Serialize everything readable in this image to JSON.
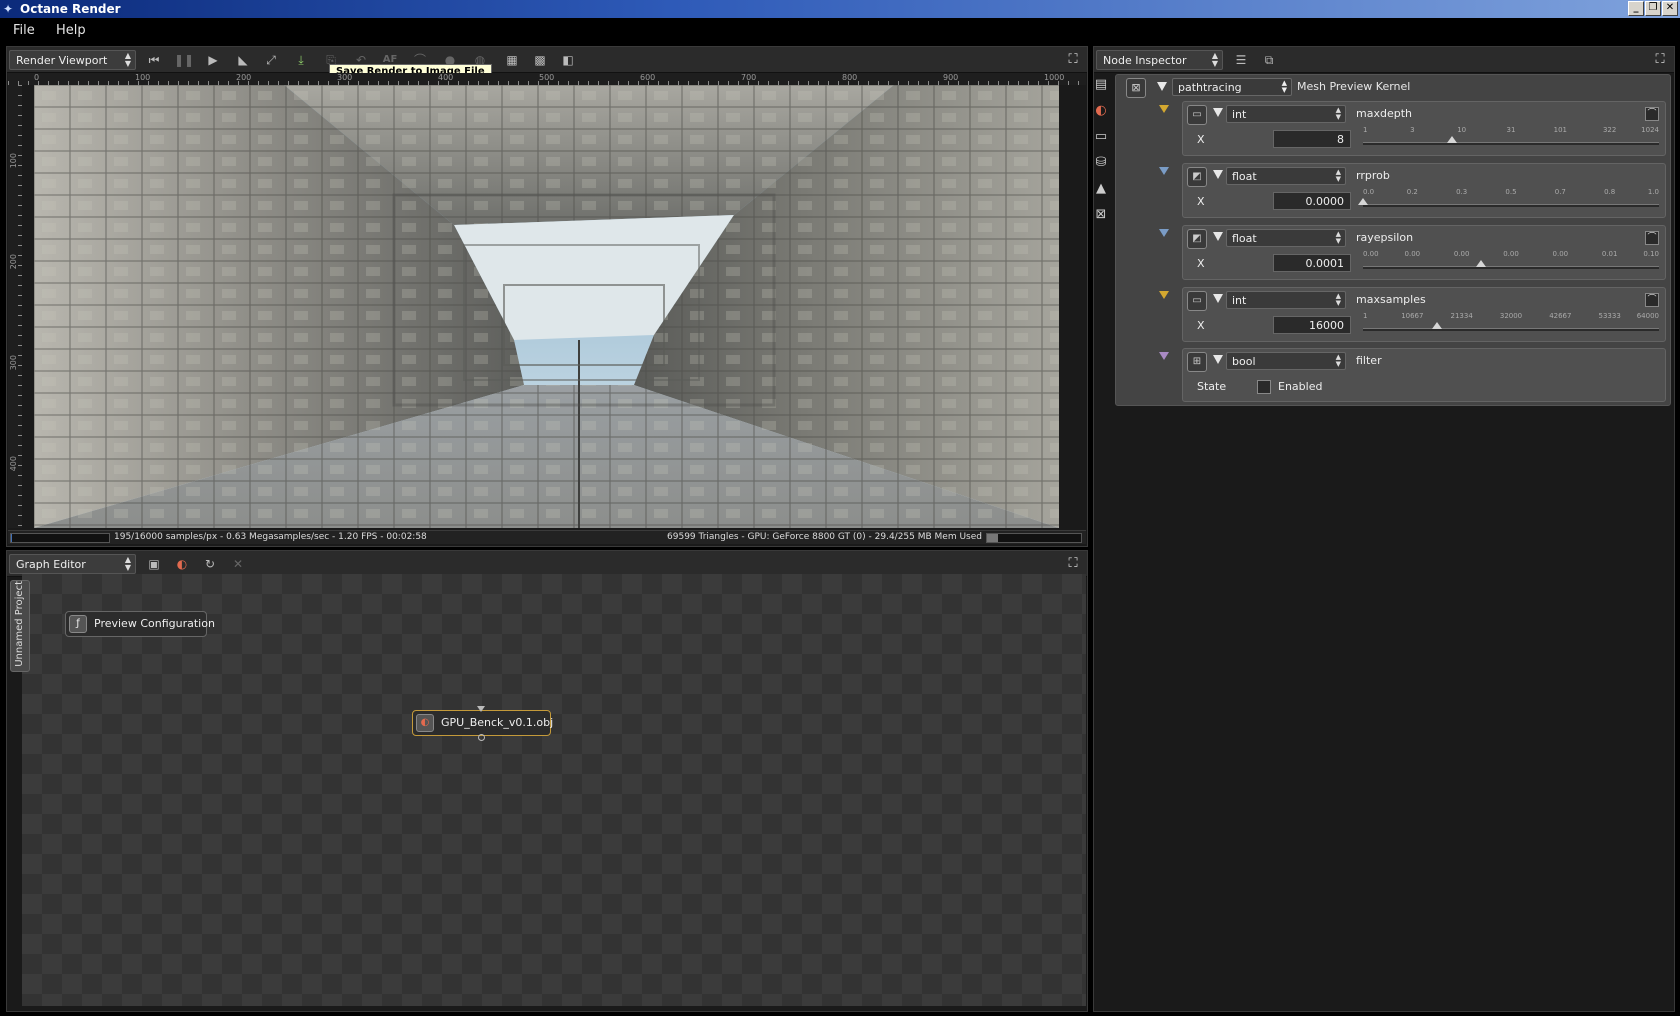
{
  "window": {
    "title": "Octane Render",
    "controls": [
      "_",
      "❐",
      "✕"
    ]
  },
  "menu": [
    "File",
    "Help"
  ],
  "render_viewport": {
    "panel_label": "Render Viewport",
    "toolbar_icons": [
      "rewind-icon",
      "pause-icon",
      "play-icon",
      "camera-icon",
      "resize-icon",
      "save-render-icon",
      "export-icon",
      "undo-icon",
      "af-icon",
      "lasso-icon",
      "color-picker-icon",
      "zoom-icon",
      "region-icon",
      "checker-icon",
      "frame-icon"
    ],
    "af_label": "AF",
    "tooltip": "Save Render to Image File",
    "ruler_h": [
      "0",
      "100",
      "200",
      "300",
      "400",
      "500",
      "600",
      "700",
      "800",
      "900",
      "1000"
    ],
    "ruler_v": [
      "100",
      "200",
      "300",
      "400"
    ],
    "status_left": "195/16000 samples/px - 0.63 Megasamples/sec - 1.20 FPS - 00:02:58",
    "status_right": "69599 Triangles - GPU: GeForce 8800 GT (0) - 29.4/255 MB Mem Used",
    "progress": 0.012,
    "mem_used_fraction": 0.115
  },
  "graph_editor": {
    "panel_label": "Graph Editor",
    "side_tab": "Unnamed Project",
    "nodes": [
      {
        "label": "Preview Configuration",
        "icon": "kernel-icon"
      },
      {
        "label": "GPU_Benck_v0.1.obj",
        "icon": "mesh-icon"
      }
    ]
  },
  "node_inspector": {
    "panel_label": "Node Inspector",
    "kernel": {
      "type": "pathtracing",
      "name": "Mesh Preview Kernel"
    },
    "params": [
      {
        "type": "int",
        "name": "maxdepth",
        "axis": "X",
        "value": "8",
        "scale": [
          "1",
          "3",
          "10",
          "31",
          "101",
          "322",
          "1024"
        ],
        "fraction": 0.3,
        "pin_color": "#d4a830"
      },
      {
        "type": "float",
        "name": "rrprob",
        "axis": "X",
        "value": "0.0000",
        "scale": [
          "0.0",
          "0.2",
          "0.3",
          "0.5",
          "0.7",
          "0.8",
          "1.0"
        ],
        "fraction": 0.0,
        "pin_color": "#7a9cc6"
      },
      {
        "type": "float",
        "name": "rayepsilon",
        "axis": "X",
        "value": "0.0001",
        "scale": [
          "0.00",
          "0.00",
          "0.00",
          "0.00",
          "0.00",
          "0.01",
          "0.10"
        ],
        "fraction": 0.4,
        "pin_color": "#7a9cc6"
      },
      {
        "type": "int",
        "name": "maxsamples",
        "axis": "X",
        "value": "16000",
        "scale": [
          "1",
          "10667",
          "21334",
          "32000",
          "42667",
          "53333",
          "64000"
        ],
        "fraction": 0.25,
        "pin_color": "#d4a830"
      }
    ],
    "bool_param": {
      "type": "bool",
      "name": "filter",
      "state_label": "State",
      "check_label": "Enabled",
      "checked": false,
      "pin_color": "#a98ac4"
    }
  }
}
